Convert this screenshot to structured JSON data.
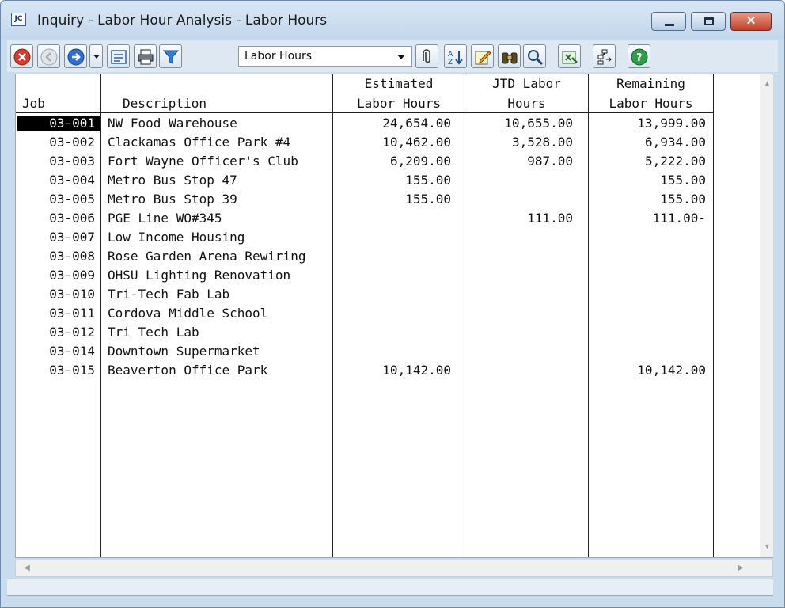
{
  "window": {
    "app_icon_text": "JC",
    "title": "Inquiry - Labor Hour Analysis - Labor Hours",
    "close_glyph": "✕"
  },
  "toolbar": {
    "view_select": {
      "value": "Labor Hours"
    }
  },
  "grid": {
    "headers": {
      "job": "Job",
      "description": "Description",
      "estimated_line1": "Estimated",
      "estimated_line2": "Labor Hours",
      "jtd_line1": "JTD Labor",
      "jtd_line2": "Hours",
      "remaining_line1": "Remaining",
      "remaining_line2": "Labor Hours"
    },
    "rows": [
      {
        "job": "03-001",
        "description": "NW Food Warehouse",
        "estimated": "24,654.00",
        "jtd": "10,655.00",
        "remaining": "13,999.00"
      },
      {
        "job": "03-002",
        "description": "Clackamas Office Park #4",
        "estimated": "10,462.00",
        "jtd": "3,528.00",
        "remaining": "6,934.00"
      },
      {
        "job": "03-003",
        "description": "Fort Wayne Officer's Club",
        "estimated": "6,209.00",
        "jtd": "987.00",
        "remaining": "5,222.00"
      },
      {
        "job": "03-004",
        "description": "Metro Bus Stop 47",
        "estimated": "155.00",
        "jtd": "",
        "remaining": "155.00"
      },
      {
        "job": "03-005",
        "description": "Metro Bus Stop 39",
        "estimated": "155.00",
        "jtd": "",
        "remaining": "155.00"
      },
      {
        "job": "03-006",
        "description": "PGE Line WO#345",
        "estimated": "",
        "jtd": "111.00",
        "remaining": "111.00-"
      },
      {
        "job": "03-007",
        "description": "Low Income Housing",
        "estimated": "",
        "jtd": "",
        "remaining": ""
      },
      {
        "job": "03-008",
        "description": "Rose Garden Arena Rewiring",
        "estimated": "",
        "jtd": "",
        "remaining": ""
      },
      {
        "job": "03-009",
        "description": "OHSU Lighting Renovation",
        "estimated": "",
        "jtd": "",
        "remaining": ""
      },
      {
        "job": "03-010",
        "description": "Tri-Tech Fab Lab",
        "estimated": "",
        "jtd": "",
        "remaining": ""
      },
      {
        "job": "03-011",
        "description": "Cordova Middle School",
        "estimated": "",
        "jtd": "",
        "remaining": ""
      },
      {
        "job": "03-012",
        "description": "Tri Tech Lab",
        "estimated": "",
        "jtd": "",
        "remaining": ""
      },
      {
        "job": "03-014",
        "description": "Downtown Supermarket",
        "estimated": "",
        "jtd": "",
        "remaining": ""
      },
      {
        "job": "03-015",
        "description": "Beaverton Office Park",
        "estimated": "10,142.00",
        "jtd": "",
        "remaining": "10,142.00"
      }
    ]
  },
  "icons": {
    "toolbar": [
      "close-icon",
      "back-icon",
      "forward-icon",
      "dropdown-arrow-icon",
      "form-view-icon",
      "print-icon",
      "filter-icon",
      "attachment-icon",
      "sort-icon",
      "edit-icon",
      "find-icon",
      "zoom-icon",
      "export-excel-icon",
      "tree-icon",
      "help-icon"
    ]
  }
}
